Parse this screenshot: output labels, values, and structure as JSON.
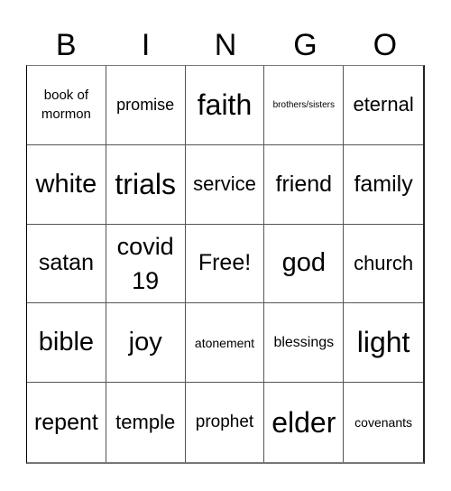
{
  "header": {
    "letters": [
      "B",
      "I",
      "N",
      "G",
      "O"
    ]
  },
  "card": {
    "rows": [
      [
        "book of mormon",
        "promise",
        "faith",
        "brothers/sisters",
        "eternal"
      ],
      [
        "white",
        "trials",
        "service",
        "friend",
        "family"
      ],
      [
        "satan",
        "covid 19",
        "Free!",
        "god",
        "church"
      ],
      [
        "bible",
        "joy",
        "atonement",
        "blessings",
        "light"
      ],
      [
        "repent",
        "temple",
        "prophet",
        "elder",
        "covenants"
      ]
    ]
  }
}
